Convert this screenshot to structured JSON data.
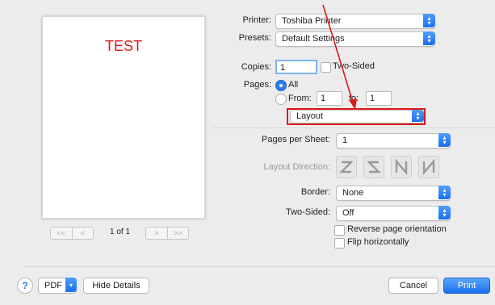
{
  "preview": {
    "sample_text": "TEST",
    "page_indicator": "1 of 1",
    "nav_first": "<<",
    "nav_prev": "<",
    "nav_next": ">",
    "nav_last": ">>"
  },
  "printer": {
    "label": "Printer:",
    "value": "Toshiba Printer"
  },
  "presets": {
    "label": "Presets:",
    "value": "Default Settings"
  },
  "copies": {
    "label": "Copies:",
    "value": "1",
    "two_sided_label": "Two-Sided"
  },
  "pages": {
    "label": "Pages:",
    "all_label": "All",
    "from_label": "From:",
    "from_value": "1",
    "to_label": "to:",
    "to_value": "1"
  },
  "section_popup": {
    "value": "Layout"
  },
  "layout": {
    "pages_per_sheet_label": "Pages per Sheet:",
    "pages_per_sheet_value": "1",
    "direction_label": "Layout Direction:",
    "border_label": "Border:",
    "border_value": "None",
    "two_sided_label": "Two-Sided:",
    "two_sided_value": "Off",
    "reverse_label": "Reverse page orientation",
    "flip_label": "Flip horizontally"
  },
  "footer": {
    "help_label": "?",
    "pdf_label": "PDF",
    "hide_details_label": "Hide Details",
    "cancel_label": "Cancel",
    "print_label": "Print"
  },
  "colors": {
    "accent": "#2e7df5",
    "highlight_red": "#e01818"
  }
}
